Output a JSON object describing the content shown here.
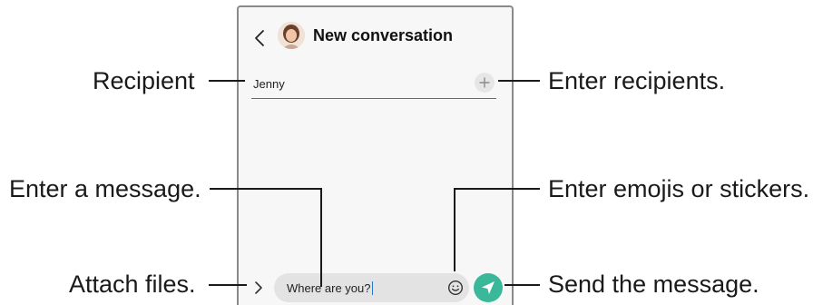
{
  "header": {
    "title": "New conversation",
    "back_icon": "chevron-left-icon",
    "avatar_icon": "contact-avatar"
  },
  "recipient_field": {
    "value": "Jenny",
    "add_icon": "plus-icon"
  },
  "composer": {
    "attach_icon": "chevron-right-icon",
    "message_value": "Where are you?",
    "emoji_icon": "smiley-icon",
    "send_icon": "send-arrow-icon",
    "send_color": "#3bb89a"
  },
  "callouts": {
    "recipient": "Recipient",
    "enter_recipients": "Enter recipients.",
    "enter_message": "Enter a message.",
    "enter_emojis": "Enter emojis or stickers.",
    "attach_files": "Attach files.",
    "send_message": "Send the message."
  }
}
